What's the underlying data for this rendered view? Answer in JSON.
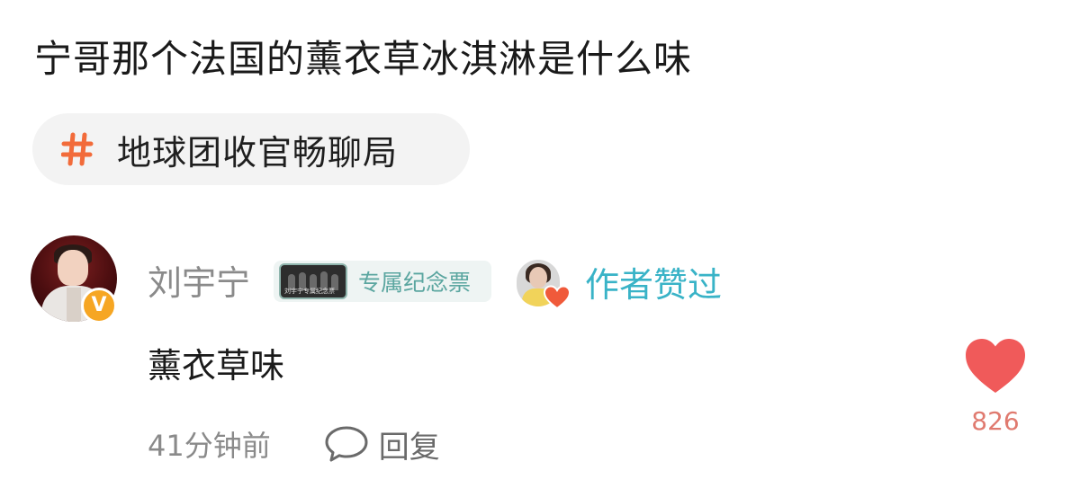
{
  "post": {
    "title": "宁哥那个法国的薰衣草冰淇淋是什么味"
  },
  "topic": {
    "label": "地球团收官畅聊局",
    "icon": "hashtag-icon",
    "icon_color": "#f26b3a"
  },
  "comment": {
    "username": "刘宇宁",
    "verified_badge": "V",
    "ticket_badge_label": "专属纪念票",
    "ticket_thumb_text": "刘宇宁专属纪念票",
    "author_liked_label": "作者赞过",
    "text": "薰衣草味",
    "timestamp": "41分钟前",
    "reply_label": "回复",
    "like_count": "826",
    "like_color": "#f05a5a",
    "accent_color": "#39b3c7"
  }
}
